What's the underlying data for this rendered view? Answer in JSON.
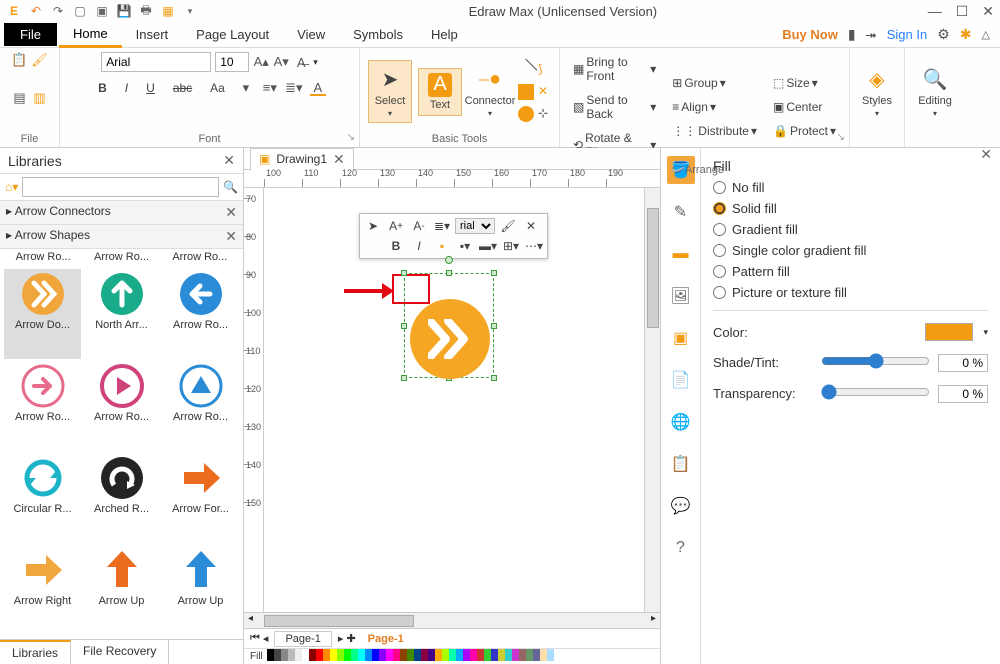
{
  "app": {
    "title": "Edraw Max (Unlicensed Version)"
  },
  "qat_icons": [
    "logo",
    "undo",
    "redo",
    "new",
    "open",
    "save",
    "print",
    "export"
  ],
  "menubar": {
    "file": "File",
    "tabs": [
      "Home",
      "Insert",
      "Page Layout",
      "View",
      "Symbols",
      "Help"
    ],
    "active": "Home",
    "buynow": "Buy Now",
    "signin": "Sign In"
  },
  "ribbon": {
    "groups": {
      "file": "File",
      "font": "Font",
      "basic_tools": "Basic Tools",
      "arrange": "Arrange",
      "styles": "Styles",
      "editing": "Editing"
    },
    "font_name": "Arial",
    "font_size": "10",
    "font_btns": [
      "B",
      "I",
      "U",
      "abc",
      "Aa"
    ],
    "tools": {
      "select": "Select",
      "text": "Text",
      "connector": "Connector"
    },
    "arrange_btns": {
      "bring_front": "Bring to Front",
      "send_back": "Send to Back",
      "rotate_flip": "Rotate & Flip",
      "group": "Group",
      "align": "Align",
      "distribute": "Distribute",
      "size": "Size",
      "center": "Center",
      "protect": "Protect"
    }
  },
  "libraries": {
    "title": "Libraries",
    "categories": [
      "Arrow Connectors",
      "Arrow Shapes"
    ],
    "row_labels_top": [
      "Arrow Ro...",
      "Arrow Ro...",
      "Arrow Ro..."
    ],
    "shapes": [
      {
        "lbl": "Arrow Do...",
        "color": "#f1a63c",
        "type": "dbl-chevron",
        "active": true
      },
      {
        "lbl": "North Arr...",
        "color": "#1aab8a",
        "type": "up"
      },
      {
        "lbl": "Arrow Ro...",
        "color": "#2a8bd6",
        "type": "left"
      },
      {
        "lbl": "Arrow Ro...",
        "color": "#e76b8a",
        "type": "right-outline"
      },
      {
        "lbl": "Arrow Ro...",
        "color": "#d0427a",
        "type": "play"
      },
      {
        "lbl": "Arrow Ro...",
        "color": "#2a8bd6",
        "type": "tri-up"
      },
      {
        "lbl": "Circular R...",
        "color": "#1db3c9",
        "type": "cycle"
      },
      {
        "lbl": "Arched R...",
        "color": "#242424",
        "type": "arch"
      },
      {
        "lbl": "Arrow For...",
        "color": "#eb6b1f",
        "type": "right-solid"
      },
      {
        "lbl": "Arrow Right",
        "color": "#f1a63c",
        "type": "right-solid"
      },
      {
        "lbl": "Arrow Up",
        "color": "#eb6b1f",
        "type": "up-solid"
      },
      {
        "lbl": "Arrow Up",
        "color": "#2a8bd6",
        "type": "up-solid"
      }
    ],
    "bottom_tabs": [
      "Libraries",
      "File Recovery"
    ]
  },
  "document": {
    "tab": "Drawing1",
    "ruler_h": [
      100,
      110,
      120,
      130,
      140,
      150,
      160,
      170,
      180,
      190
    ],
    "ruler_v": [
      70,
      80,
      90,
      100,
      110,
      120,
      130,
      140,
      150
    ],
    "page_tab": "Page-1",
    "active_page": "Page-1",
    "fill_label": "Fill"
  },
  "float_toolbar": {
    "font": "rial",
    "btns_top": [
      "pointer",
      "A+",
      "A-",
      "bullets",
      "font",
      "brush"
    ],
    "btns_bot": [
      "B",
      "I",
      "color",
      "fill",
      "line",
      "group",
      "..."
    ]
  },
  "fill_panel": {
    "title": "Fill",
    "options": [
      "No fill",
      "Solid fill",
      "Gradient fill",
      "Single color gradient fill",
      "Pattern fill",
      "Picture or texture fill"
    ],
    "selected": "Solid fill",
    "color_label": "Color:",
    "color_value": "#f39c12",
    "shade_label": "Shade/Tint:",
    "shade_value": "0 %",
    "transparency_label": "Transparency:",
    "transparency_value": "0 %"
  },
  "side_tooltabs": [
    "bucket",
    "pen",
    "square",
    "image",
    "layers",
    "doc",
    "globe",
    "clipboard",
    "chat",
    "help"
  ]
}
